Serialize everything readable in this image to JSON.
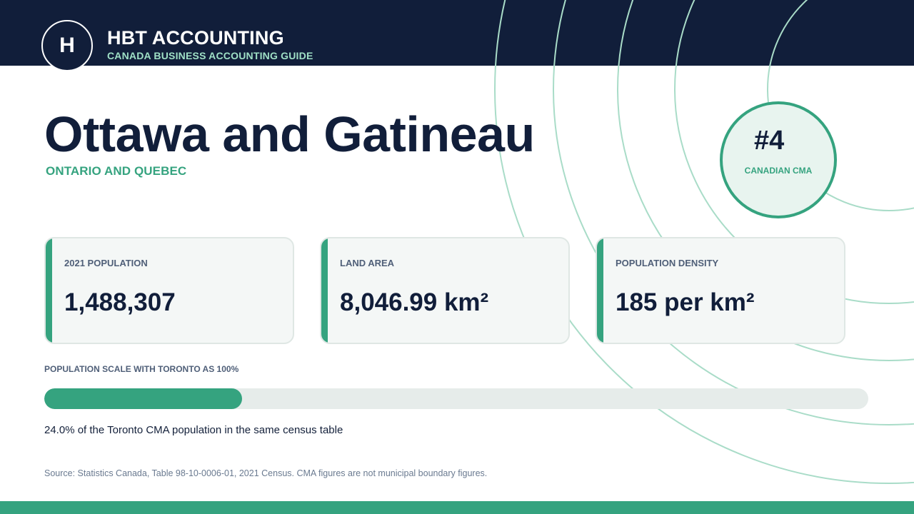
{
  "header": {
    "logo_letter": "H",
    "brand": "HBT ACCOUNTING",
    "tagline": "CANADA BUSINESS ACCOUNTING GUIDE"
  },
  "page": {
    "title": "Ottawa and Gatineau",
    "subtitle": "ONTARIO AND QUEBEC"
  },
  "rank": {
    "value": "#4",
    "label": "CANADIAN CMA"
  },
  "stats": [
    {
      "label": "2021 POPULATION",
      "value": "1,488,307"
    },
    {
      "label": "LAND AREA",
      "value": "8,046.99 km²"
    },
    {
      "label": "POPULATION DENSITY",
      "value": "185 per km²"
    }
  ],
  "scale": {
    "label": "POPULATION SCALE WITH TORONTO AS 100%",
    "percent": 24.0,
    "caption": "24.0% of the Toronto CMA population in the same census table"
  },
  "source": "Source: Statistics Canada, Table 98-10-0006-01, 2021 Census. CMA figures are not municipal boundary figures.",
  "colors": {
    "navy": "#111e3a",
    "accent_green": "#35a37f",
    "tagline_mint": "#9fe0c6",
    "ring_mint": "#a9dcc8"
  }
}
